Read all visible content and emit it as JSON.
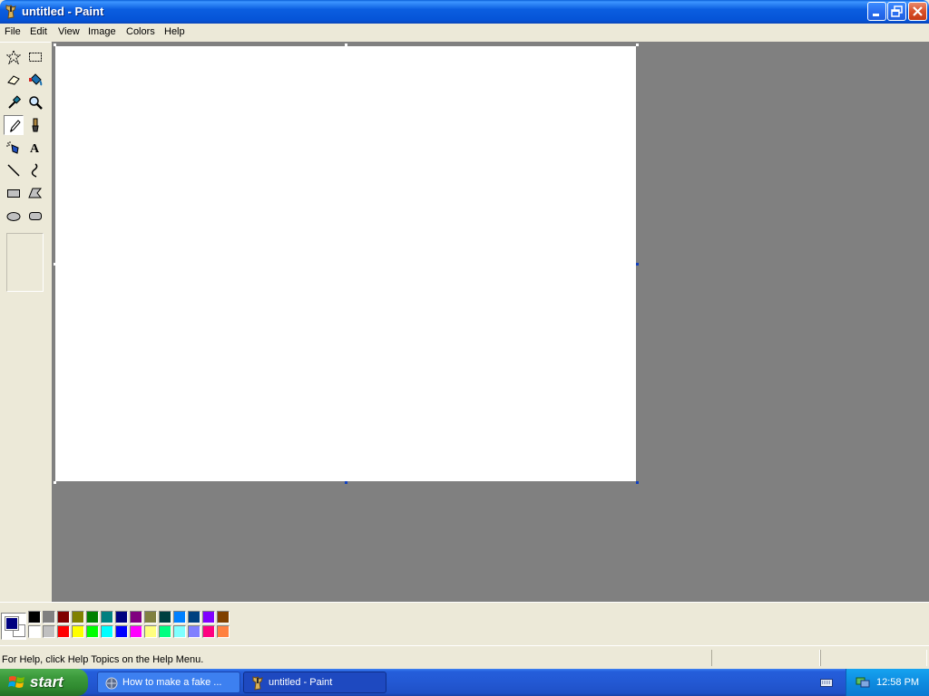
{
  "window": {
    "title": "untitled - Paint"
  },
  "menu": [
    "File",
    "Edit",
    "View",
    "Image",
    "Colors",
    "Help"
  ],
  "toolbox": {
    "tools": [
      {
        "name": "free-form-select",
        "icon": "star-select-icon"
      },
      {
        "name": "select",
        "icon": "rect-select-icon"
      },
      {
        "name": "eraser",
        "icon": "eraser-icon"
      },
      {
        "name": "fill-with-color",
        "icon": "paint-bucket-icon"
      },
      {
        "name": "pick-color",
        "icon": "eyedropper-icon"
      },
      {
        "name": "magnifier",
        "icon": "magnifier-icon"
      },
      {
        "name": "pencil",
        "icon": "pencil-icon",
        "active": true
      },
      {
        "name": "brush",
        "icon": "brush-icon"
      },
      {
        "name": "airbrush",
        "icon": "airbrush-icon"
      },
      {
        "name": "text",
        "icon": "text-icon"
      },
      {
        "name": "line",
        "icon": "line-icon"
      },
      {
        "name": "curve",
        "icon": "curve-icon"
      },
      {
        "name": "rectangle",
        "icon": "rectangle-icon"
      },
      {
        "name": "polygon",
        "icon": "polygon-icon"
      },
      {
        "name": "ellipse",
        "icon": "ellipse-icon"
      },
      {
        "name": "rounded-rectangle",
        "icon": "rounded-rectangle-icon"
      }
    ]
  },
  "colors": {
    "foreground": "#000080",
    "background": "#ffffff",
    "palette_top": [
      "#000000",
      "#808080",
      "#800000",
      "#808000",
      "#008000",
      "#008080",
      "#000080",
      "#800080",
      "#808040",
      "#004040",
      "#0080ff",
      "#004080",
      "#8000ff",
      "#804000"
    ],
    "palette_bottom": [
      "#ffffff",
      "#c0c0c0",
      "#ff0000",
      "#ffff00",
      "#00ff00",
      "#00ffff",
      "#0000ff",
      "#ff00ff",
      "#ffff80",
      "#00ff80",
      "#80ffff",
      "#8080ff",
      "#ff0080",
      "#ff8040"
    ]
  },
  "status": {
    "help_text": "For Help, click Help Topics on the Help Menu."
  },
  "taskbar": {
    "start_label": "start",
    "tasks": [
      {
        "label": "How to make a fake ...",
        "active": false
      },
      {
        "label": "untitled - Paint",
        "active": true
      }
    ],
    "clock": "12:58 PM"
  }
}
